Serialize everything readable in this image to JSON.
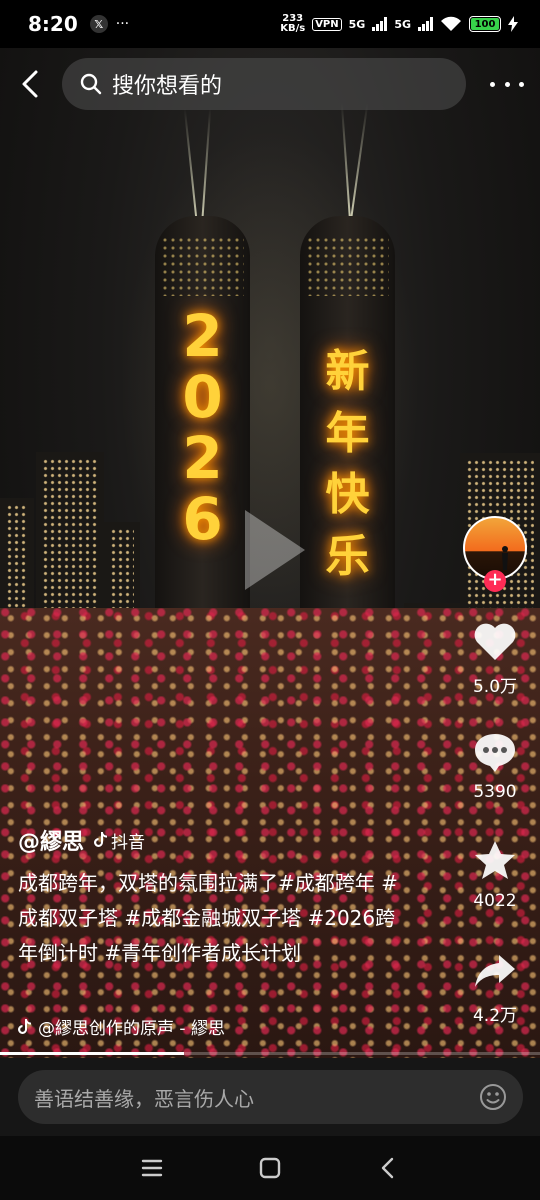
{
  "status_bar": {
    "time": "8:20",
    "net_speed_value": "233",
    "net_speed_unit": "KB/s",
    "vpn": "VPN",
    "sim1": "5G",
    "sim2": "5G",
    "battery": "100",
    "battery_level": 1.0
  },
  "top_bar": {
    "search_placeholder": "搜你想看的"
  },
  "video": {
    "tower_left_text": "2026",
    "tower_right_text": "新年快乐",
    "progress": 0.34
  },
  "rail": {
    "likes": "5.0万",
    "comments": "5390",
    "favorites": "4022",
    "shares": "4.2万"
  },
  "caption": {
    "author": "@繆思",
    "platform": "抖音",
    "description": "成都跨年，双塔的氛围拉满了#成都跨年 #成都双子塔 #成都金融城双子塔 #2026跨年倒计时 #青年创作者成长计划",
    "music": "@繆思创作的原声 - 繆思"
  },
  "comment_bar": {
    "placeholder": "善语结善缘，恶言伤人心"
  },
  "colors": {
    "accent": "#fe2c55",
    "battery": "#37d24a"
  }
}
